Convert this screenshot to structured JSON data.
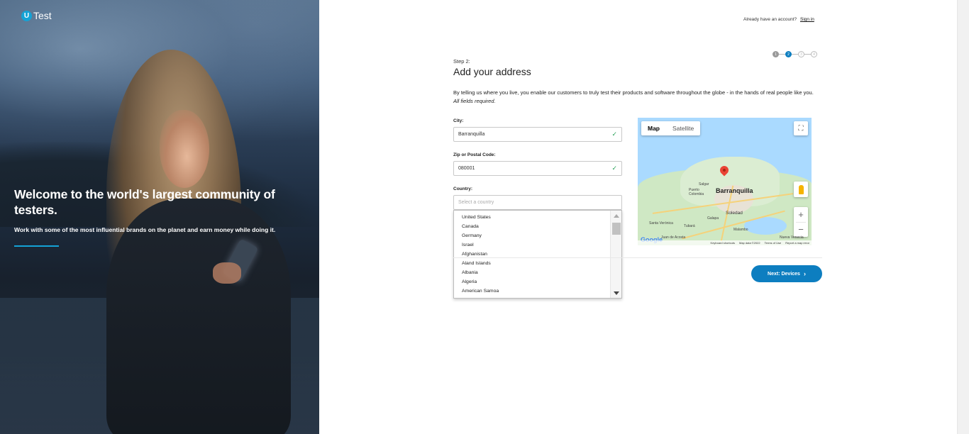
{
  "brand": {
    "logo_letter": "U",
    "logo_word": "Test",
    "accent": "#14a3d6",
    "primary": "#0d7ec0"
  },
  "hero": {
    "headline": "Welcome to the world's largest community of testers.",
    "subtext": "Work with some of the most influential brands on the planet and earn money while doing it."
  },
  "header": {
    "account_prompt": "Already have an account?",
    "signin_link": "Sign in"
  },
  "stepper": {
    "steps": [
      "1",
      "2",
      "3",
      "4"
    ],
    "current": 2
  },
  "form": {
    "step_label": "Step 2:",
    "title": "Add your address",
    "intro": "By telling us where you live, you enable our customers to truly test their products and software throughout the globe - in the hands of real people like you.",
    "intro_emphasis": "All fields required.",
    "city": {
      "label": "City:",
      "value": "Barranquilla"
    },
    "zip": {
      "label": "Zip or Postal Code:",
      "value": "080001"
    },
    "country": {
      "label": "Country:",
      "placeholder": "Select a country",
      "options": [
        "United States",
        "Canada",
        "Germany",
        "Israel",
        "Afghanistan",
        "Aland Islands",
        "Albania",
        "Algeria",
        "American Samoa"
      ]
    },
    "next_button": "Next: Devices"
  },
  "map": {
    "tabs": [
      "Map",
      "Satellite"
    ],
    "active_tab": "Map",
    "labels": {
      "main_city": "Barranquilla",
      "soledad": "Soledad",
      "salgar": "Salgar",
      "puerto_colombia": "Puerto Colombia",
      "galapa": "Galapa",
      "malambo": "Malambo",
      "tubara": "Tubará",
      "santa_veronica": "Santa Verónica",
      "juan_de_acosta": "Juan de Acosta",
      "nueva_venecia": "Nueva Venecia"
    },
    "google_logo": "Google",
    "footer": [
      "Keyboard shortcuts",
      "Map data ©2022",
      "Terms of Use",
      "Report a map error"
    ]
  }
}
